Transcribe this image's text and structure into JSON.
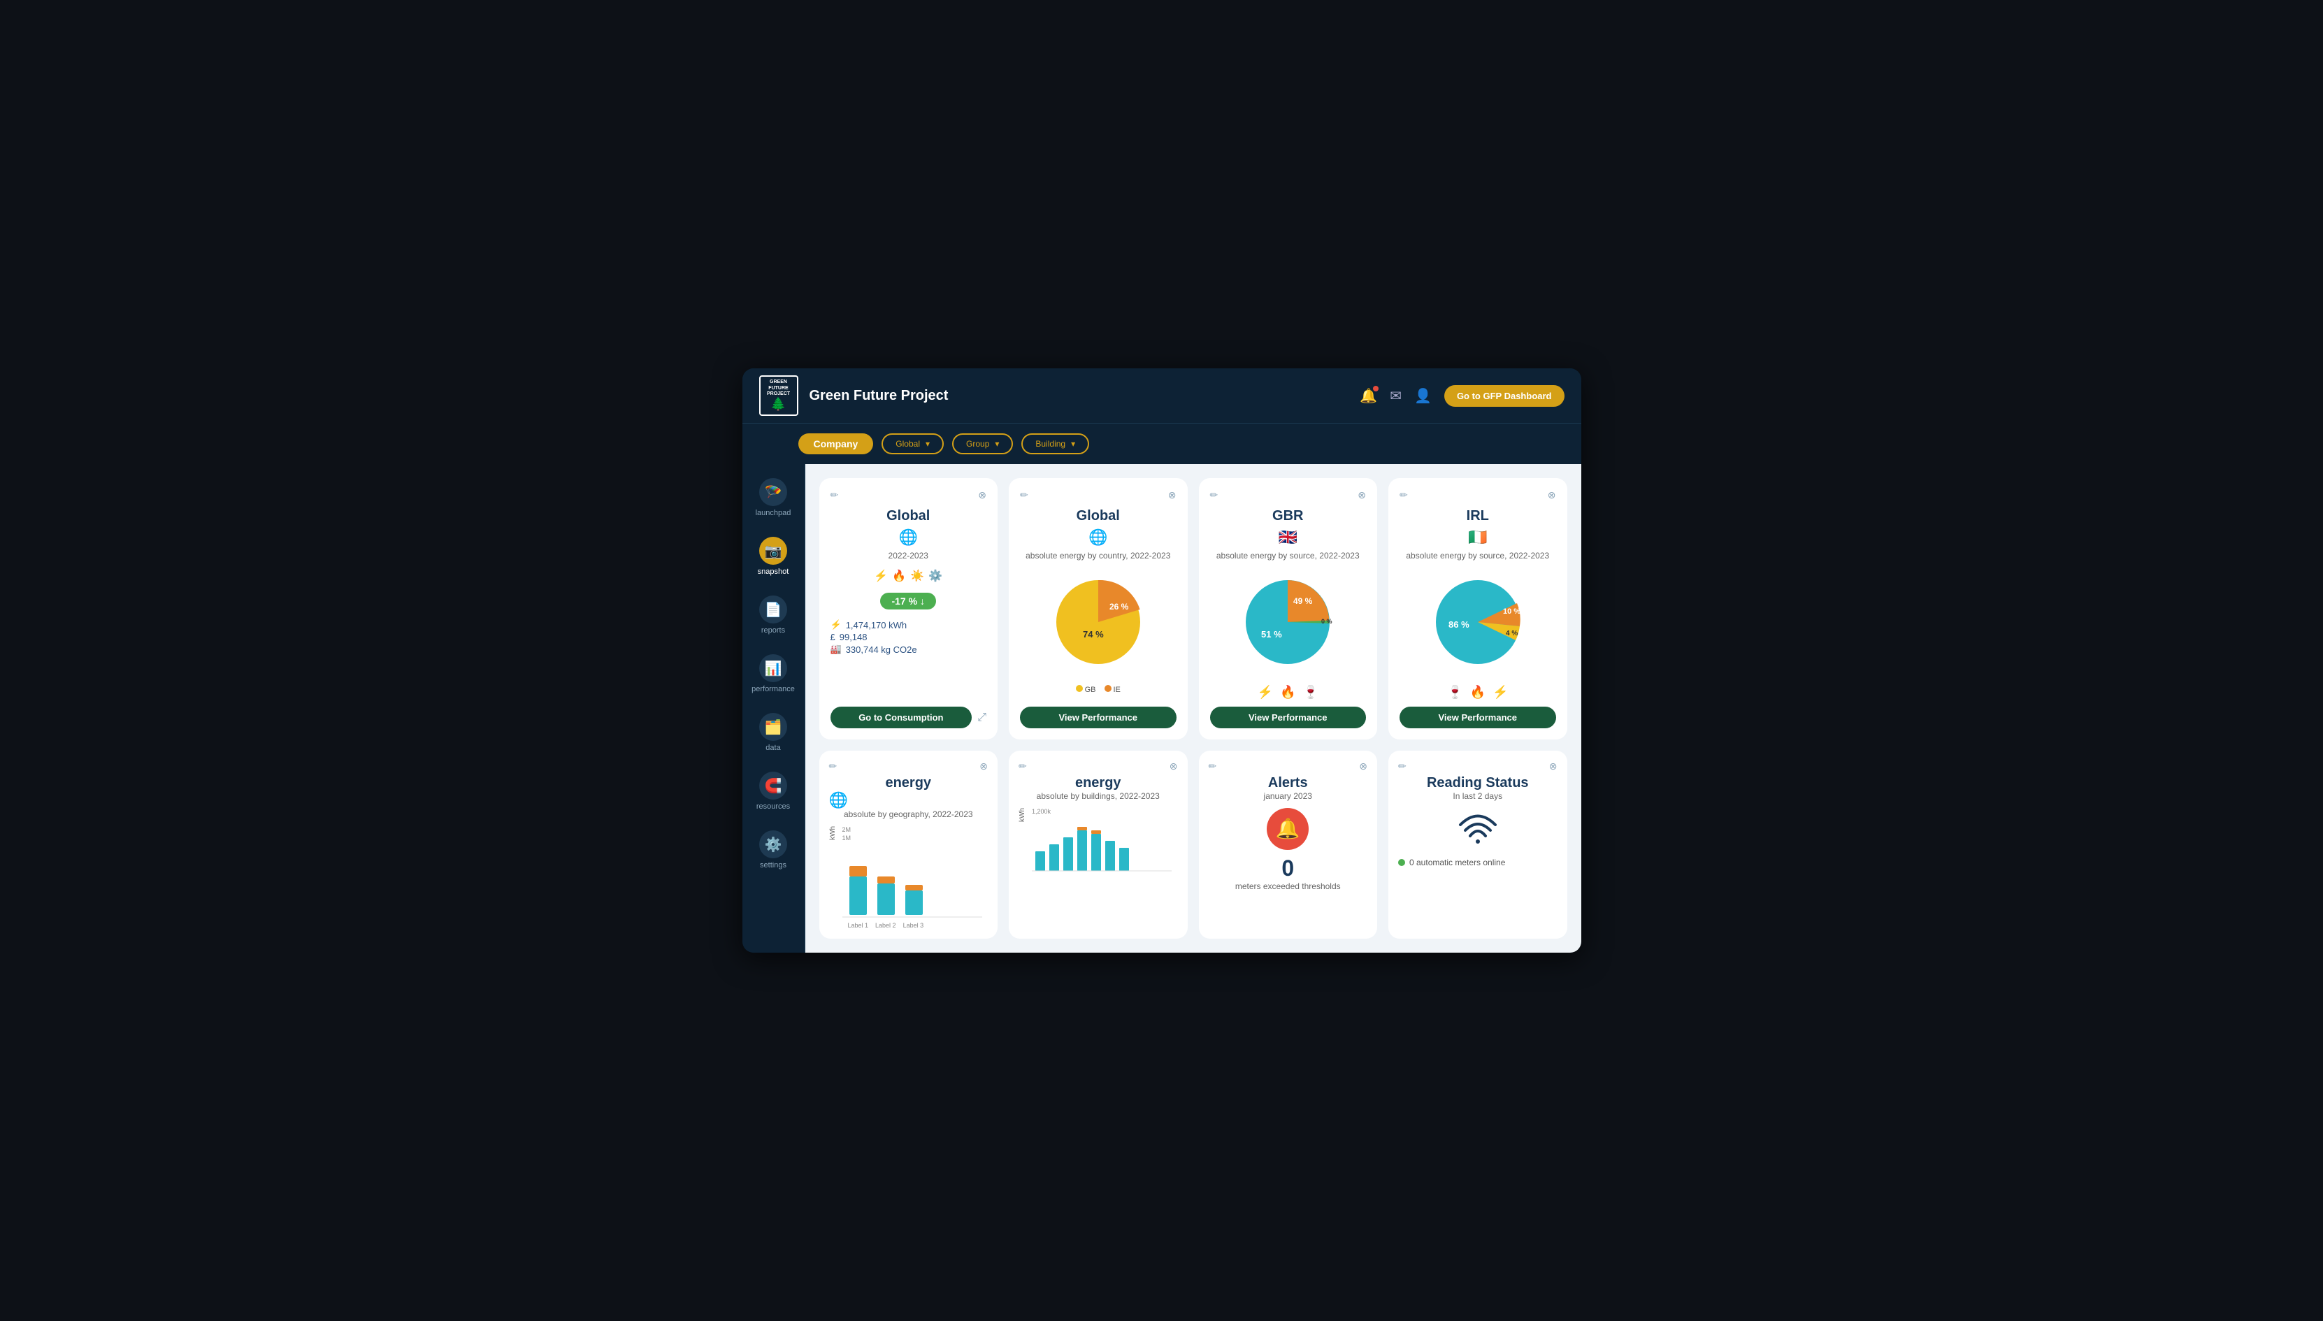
{
  "app": {
    "title": "Green Future Project",
    "gfp_btn": "Go to GFP Dashboard"
  },
  "header": {
    "logo_lines": [
      "GREEN",
      "FUTURE",
      "PROJECT"
    ]
  },
  "filters": {
    "company": "Company",
    "global": "Global",
    "group": "Group",
    "building": "Building"
  },
  "sidebar": {
    "items": [
      {
        "id": "launchpad",
        "label": "launchpad",
        "icon": "🪂"
      },
      {
        "id": "snapshot",
        "label": "snapshot",
        "icon": "📷"
      },
      {
        "id": "reports",
        "label": "reports",
        "icon": "📄"
      },
      {
        "id": "performance",
        "label": "performance",
        "icon": "📊"
      },
      {
        "id": "data",
        "label": "data",
        "icon": "🗂️"
      },
      {
        "id": "resources",
        "label": "resources",
        "icon": "🧲"
      },
      {
        "id": "settings",
        "label": "settings",
        "icon": "⚙️"
      }
    ]
  },
  "cards": [
    {
      "id": "card-global-1",
      "title": "Global",
      "globe": "🌐",
      "subtitle": "2022-2023",
      "energy_icons": [
        "⚡",
        "🔥",
        "☀️",
        "⚙️"
      ],
      "badge": "-17 %",
      "kwh": "1,474,170 kWh",
      "cost": "99,148",
      "co2": "330,744 kg CO2e",
      "btn_label": "Go to Consumption",
      "type": "summary"
    },
    {
      "id": "card-global-2",
      "title": "Global",
      "globe": "🌐",
      "subtitle": "absolute energy by country, 2022-2023",
      "btn_label": "View Performance",
      "type": "pie",
      "pie_segments": [
        {
          "label": "74 %",
          "value": 74,
          "color": "#f0c020"
        },
        {
          "label": "26 %",
          "value": 26,
          "color": "#e8882a"
        }
      ],
      "legend": [
        {
          "label": "GB",
          "color": "#f0c020"
        },
        {
          "label": "IE",
          "color": "#e8882a"
        }
      ]
    },
    {
      "id": "card-gbr",
      "title": "GBR",
      "flag": "🇬🇧",
      "subtitle": "absolute energy by source, 2022-2023",
      "btn_label": "View Performance",
      "type": "pie",
      "pie_segments": [
        {
          "label": "49 %",
          "value": 49,
          "color": "#e8882a"
        },
        {
          "label": "51 %",
          "value": 51,
          "color": "#2ab8c8"
        },
        {
          "label": "0 %",
          "value": 1,
          "color": "#4caf50"
        }
      ],
      "source_icons": [
        "⚡",
        "🔥",
        "🍷"
      ]
    },
    {
      "id": "card-irl",
      "title": "IRL",
      "flag": "🇮🇪",
      "subtitle": "absolute energy by source, 2022-2023",
      "btn_label": "View Performance",
      "type": "pie",
      "pie_segments": [
        {
          "label": "86 %",
          "value": 86,
          "color": "#2ab8c8"
        },
        {
          "label": "10 %",
          "value": 10,
          "color": "#e8882a"
        },
        {
          "label": "4 %",
          "value": 4,
          "color": "#f0c020"
        }
      ],
      "source_icons": [
        "🍷",
        "🔥",
        "⚡"
      ]
    }
  ],
  "bottom_cards": [
    {
      "id": "energy-geo",
      "title": "energy",
      "globe": "🌐",
      "subtitle": "absolute by geography, 2022-2023",
      "y_label": "kWh",
      "y_ticks": [
        "2M",
        "1M"
      ],
      "type": "bar"
    },
    {
      "id": "energy-buildings",
      "title": "energy",
      "subtitle": "absolute by buildings, 2022-2023",
      "y_label": "kWh",
      "y_ticks": [
        "1,200k"
      ],
      "type": "bar2"
    },
    {
      "id": "alerts",
      "title": "Alerts",
      "subtitle": "january 2023",
      "count": "0",
      "count_label": "meters exceeded thresholds",
      "type": "alerts"
    },
    {
      "id": "reading-status",
      "title": "Reading Status",
      "subtitle": "In last 2 days",
      "auto_meters": "0 automatic meters online",
      "type": "reading"
    }
  ],
  "icons": {
    "close": "✕",
    "edit": "✏️",
    "expand": "⤢",
    "menu": "≡",
    "bell": "🔔",
    "send": "✉",
    "user": "👤",
    "chevron_down": "▾",
    "down_arrow": "↓",
    "wifi": "📶"
  }
}
